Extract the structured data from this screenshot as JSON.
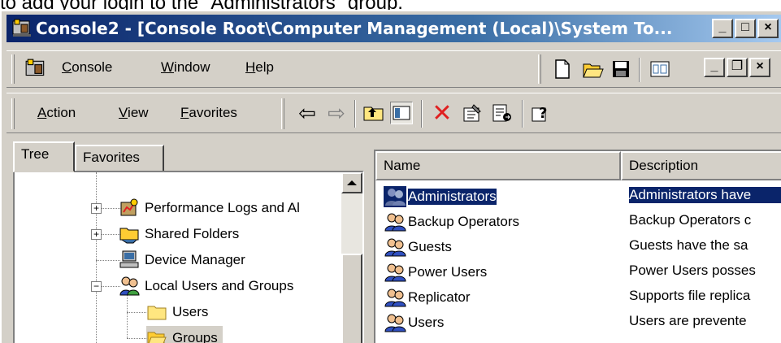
{
  "caption": {
    "text": "to add your login to the \"Administrators\" group."
  },
  "window": {
    "title": "Console2 - [Console Root\\Computer Management (Local)\\System To...",
    "controls": {
      "minimize": "_",
      "maximize": "□",
      "close": "×"
    }
  },
  "menubar": {
    "items": [
      {
        "label_pre": "",
        "label_ul": "C",
        "label_post": "onsole"
      },
      {
        "label_pre": "",
        "label_ul": "W",
        "label_post": "indow"
      },
      {
        "label_pre": "",
        "label_ul": "H",
        "label_post": "elp"
      }
    ],
    "right_controls": {
      "minimize": "_",
      "restore": "❐",
      "close": "×"
    }
  },
  "toolbar": {
    "items": [
      {
        "label_pre": "",
        "label_ul": "A",
        "label_post": "ction"
      },
      {
        "label_pre": "",
        "label_ul": "V",
        "label_post": "iew"
      },
      {
        "label_pre": "",
        "label_ul": "F",
        "label_post": "avorites"
      }
    ],
    "back_arrow": "⇦",
    "forward_arrow": "⇨"
  },
  "tabs": {
    "tree": "Tree",
    "favorites": "Favorites"
  },
  "tree": {
    "nodes": [
      {
        "label": "Performance Logs and Al",
        "expander": "+",
        "icon": "performance-logs-icon"
      },
      {
        "label": "Shared Folders",
        "expander": "+",
        "icon": "shared-folders-icon"
      },
      {
        "label": "Device Manager",
        "expander": "",
        "icon": "device-manager-icon"
      },
      {
        "label": "Local Users and Groups",
        "expander": "−",
        "icon": "local-users-icon"
      },
      {
        "label": "Users",
        "expander": "",
        "icon": "folder-icon"
      },
      {
        "label": "Groups",
        "expander": "",
        "icon": "folder-open-icon",
        "selected": true
      }
    ]
  },
  "list": {
    "columns": [
      "Name",
      "Description"
    ],
    "rows": [
      {
        "name": "Administrators",
        "description": "Administrators have",
        "selected": true
      },
      {
        "name": "Backup Operators",
        "description": "Backup Operators c"
      },
      {
        "name": "Guests",
        "description": "Guests have the sa"
      },
      {
        "name": "Power Users",
        "description": "Power Users posses"
      },
      {
        "name": "Replicator",
        "description": "Supports file replica"
      },
      {
        "name": "Users",
        "description": "Users are prevente"
      }
    ]
  },
  "colors": {
    "titlebar": "#0a246a",
    "selection": "#0a246a",
    "face": "#d4d0c8"
  }
}
